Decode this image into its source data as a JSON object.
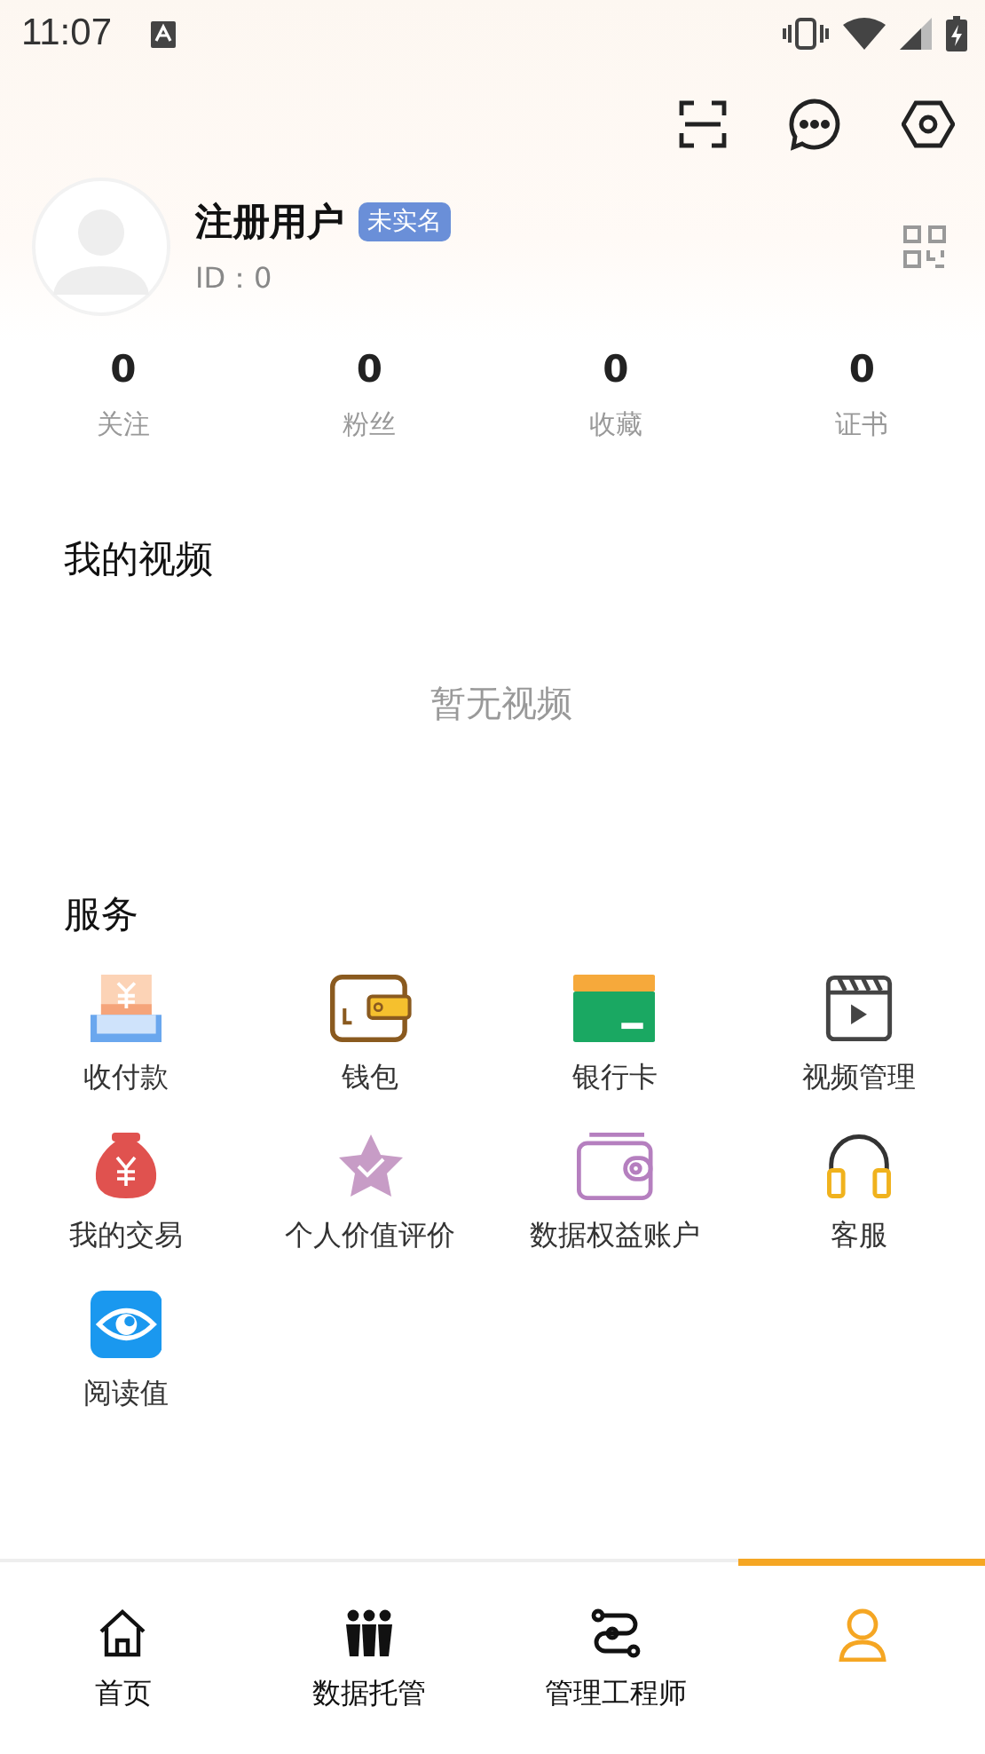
{
  "status_bar": {
    "time": "11:07"
  },
  "profile": {
    "name": "注册用户",
    "badge": "未实名",
    "id": "ID：0"
  },
  "stats": [
    {
      "value": "0",
      "label": "关注"
    },
    {
      "value": "0",
      "label": "粉丝"
    },
    {
      "value": "0",
      "label": "收藏"
    },
    {
      "value": "0",
      "label": "证书"
    }
  ],
  "videos": {
    "title": "我的视频",
    "empty": "暂无视频"
  },
  "services": {
    "title": "服务",
    "items": [
      {
        "kind": "receive",
        "label": "收付款"
      },
      {
        "kind": "wallet",
        "label": "钱包"
      },
      {
        "kind": "card",
        "label": "银行卡"
      },
      {
        "kind": "video",
        "label": "视频管理"
      },
      {
        "kind": "bag",
        "label": "我的交易"
      },
      {
        "kind": "star",
        "label": "个人价值评价"
      },
      {
        "kind": "purse",
        "label": "数据权益账户"
      },
      {
        "kind": "headset",
        "label": "客服"
      },
      {
        "kind": "eye",
        "label": "阅读值"
      }
    ]
  },
  "tabs": [
    {
      "kind": "home",
      "label": "首页",
      "selected": false
    },
    {
      "kind": "people",
      "label": "数据托管",
      "selected": false
    },
    {
      "kind": "route",
      "label": "管理工程师",
      "selected": false
    },
    {
      "kind": "user",
      "selected": true
    }
  ]
}
